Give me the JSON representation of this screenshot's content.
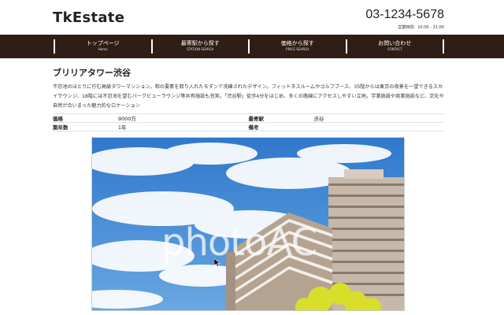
{
  "header": {
    "logo": "TkEstate",
    "phone": "03-1234-5678",
    "hours": "営業時間：10:00 - 21:00"
  },
  "nav": {
    "items": [
      {
        "label": "トップページ",
        "sub": "Home"
      },
      {
        "label": "最寄駅から探す",
        "sub": "STATION SEARCH"
      },
      {
        "label": "価格から探す",
        "sub": "PRICE SEARCH"
      },
      {
        "label": "お問い合わせ",
        "sub": "CONTACT"
      }
    ]
  },
  "property": {
    "title": "ブリリアタワー渋谷",
    "description": "不忍池のほとりに佇む高級タワーマンション。和の要素を取り入れたモダンで洗練されたデザイン。フィットネスルームやゴルフブース、35階からは東京の夜景を一望できるスカイラウンジ、18階には不忍池を望むパークビューラウンジ等共有施設も充実。「渋谷駅」徒歩4分をはじめ、多くの路線にアクセスしやすい立地。学業施設や商業施設など、文化や自然が合いまった魅力的なロケーション",
    "specs": {
      "price_label": "価格",
      "price_value": "9000万",
      "station_label": "最寄駅",
      "station_value": "渋谷",
      "age_label": "築年数",
      "age_value": "1年",
      "notes_label": "備考",
      "notes_value": ""
    },
    "photo_watermark": "photoAC"
  },
  "colors": {
    "nav_bg": "#2e1e16",
    "sky": "#3f86d2"
  }
}
